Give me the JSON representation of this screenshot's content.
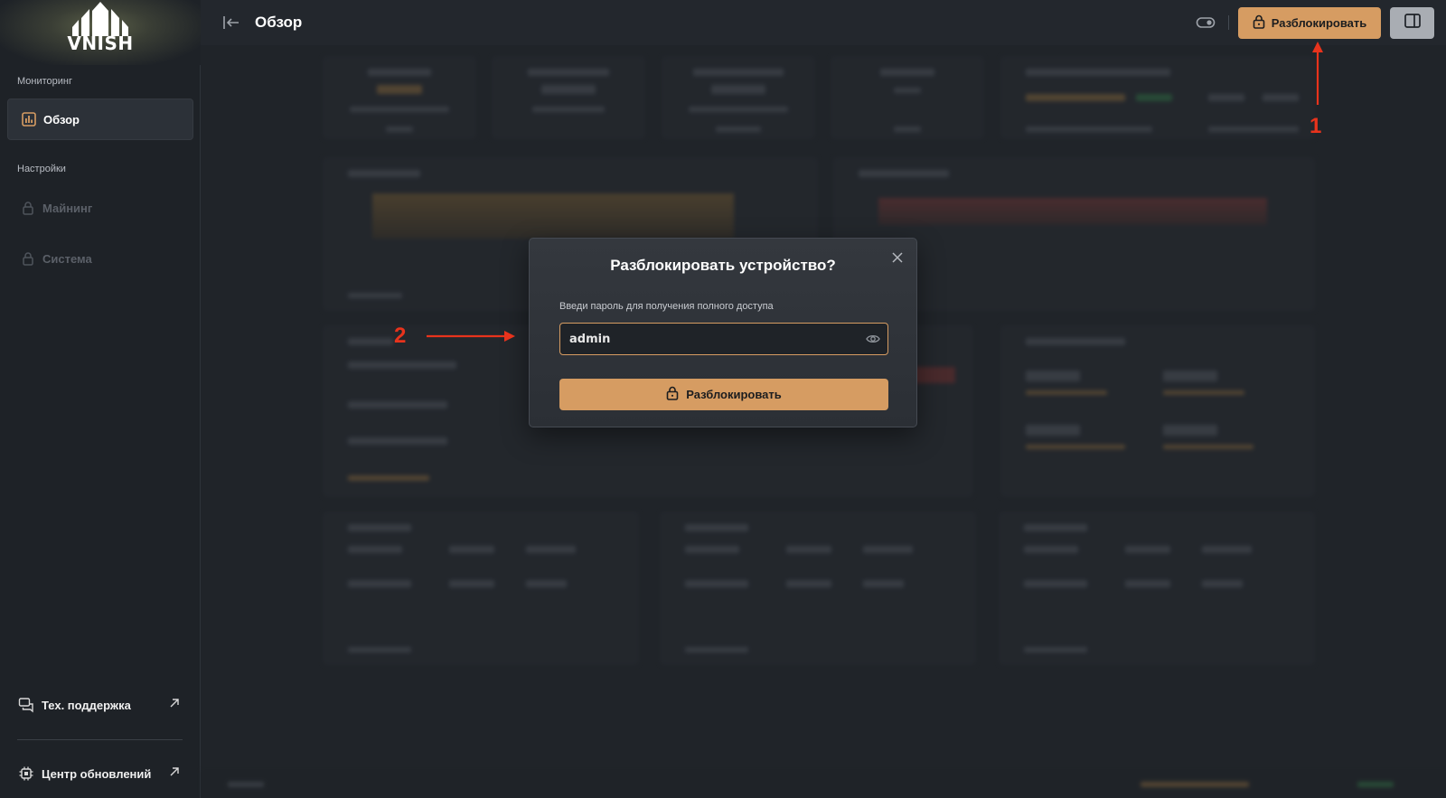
{
  "brand": {
    "logo_text": "VNISH"
  },
  "sidebar": {
    "monitoring_title": "Мониторинг",
    "overview_label": "Обзор",
    "settings_title": "Настройки",
    "mining_label": "Майнинг",
    "system_label": "Система",
    "support_label": "Тех. поддержка",
    "updates_label": "Центр обновлений"
  },
  "header": {
    "title": "Обзор",
    "unlock_label": "Разблокировать"
  },
  "modal": {
    "title": "Разблокировать устройство?",
    "label": "Введи пароль для получения полного доступа",
    "password_value": "admin",
    "unlock_label": "Разблокировать"
  },
  "annotations": {
    "marker_1": "1",
    "marker_2": "2"
  },
  "colors": {
    "accent": "#d69c62",
    "background": "#23272d",
    "sidebar": "#1e2227",
    "annotation": "#e8331c"
  },
  "icons": {
    "overview": "bar-chart-icon",
    "lock": "lock-icon",
    "support": "chat-icon",
    "updates": "chip-icon",
    "external": "arrow-up-right-icon",
    "close": "close-icon",
    "eye": "eye-icon",
    "panel": "panel-icon",
    "collapse": "collapse-arrow-icon",
    "toggle": "toggle-icon"
  }
}
